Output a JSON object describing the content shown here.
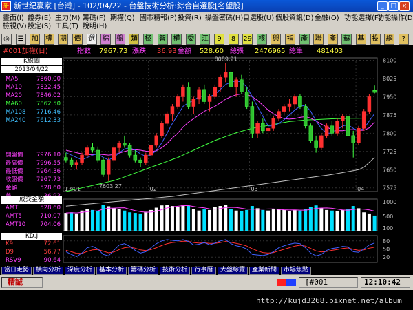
{
  "window": {
    "title": "新世紀贏家 [台灣] - 102/04/22 - 台盤技術分析:綜合自選股[名望股]"
  },
  "menu": [
    {
      "label": "畫面(I)",
      "x": 4,
      "y": 20
    },
    {
      "label": "證券(E)",
      "x": 40,
      "y": 20
    },
    {
      "label": "主力(M)",
      "x": 80,
      "y": 20
    },
    {
      "label": "籌碼(F)",
      "x": 120,
      "y": 20
    },
    {
      "label": "期權(Q)",
      "x": 160,
      "y": 20
    },
    {
      "label": "國市精報(P)",
      "x": 203,
      "y": 20
    },
    {
      "label": "投資(R)",
      "x": 258,
      "y": 20
    },
    {
      "label": "操盤密碼(H)",
      "x": 298,
      "y": 20
    },
    {
      "label": "自選股(U)",
      "x": 353,
      "y": 20
    },
    {
      "label": "個股資訊(D)",
      "x": 400,
      "y": 20
    },
    {
      "label": "金融(O)",
      "x": 457,
      "y": 20
    },
    {
      "label": "功能選擇(F)",
      "x": 500,
      "y": 20
    },
    {
      "label": "功能操作(D)",
      "x": 548,
      "y": 20
    },
    {
      "label": "檢視(V)",
      "x": 4,
      "y": 32
    },
    {
      "label": "設定(S)",
      "x": 40,
      "y": 32
    },
    {
      "label": "工具(T)",
      "x": 80,
      "y": 32
    },
    {
      "label": "說明(H)",
      "x": 120,
      "y": 32
    }
  ],
  "toolbar": [
    {
      "t": "◎",
      "bg": "#d4d0c8"
    },
    {
      "t": "☰",
      "bg": "#d4d0c8"
    },
    {
      "t": "加",
      "bg": "#e0c060"
    },
    {
      "t": "權",
      "bg": "#e0c060"
    },
    {
      "t": "期",
      "bg": "#e0c060"
    },
    {
      "t": "價",
      "bg": "#e0c060"
    },
    {
      "t": "選",
      "bg": "#f0f0f0"
    },
    {
      "t": "綜",
      "bg": "#d080d0"
    },
    {
      "t": "盤",
      "bg": "#d080d0"
    },
    {
      "t": "類",
      "bg": "#d0c040"
    },
    {
      "t": "極",
      "bg": "#70c070"
    },
    {
      "t": "智",
      "bg": "#70c070"
    },
    {
      "t": "權",
      "bg": "#70c070"
    },
    {
      "t": "委",
      "bg": "#70c070"
    },
    {
      "t": "江",
      "bg": "#70c070"
    },
    {
      "t": "9",
      "bg": "#e0e040"
    },
    {
      "t": "8",
      "bg": "#e0e040"
    },
    {
      "t": "29",
      "bg": "#e0e040"
    },
    {
      "t": "核",
      "bg": "#70c070"
    },
    {
      "t": "興",
      "bg": "#e0c060"
    },
    {
      "t": "指",
      "bg": "#e0c060"
    },
    {
      "t": "產",
      "bg": "#70c070"
    },
    {
      "t": "聯",
      "bg": "#e0c060"
    },
    {
      "t": "產",
      "bg": "#e0c060"
    },
    {
      "t": "蘇",
      "bg": "#70c070"
    },
    {
      "t": "基",
      "bg": "#e0c060"
    },
    {
      "t": "投",
      "bg": "#e0c060"
    },
    {
      "t": "網",
      "bg": "#e0c060"
    },
    {
      "t": "?",
      "bg": "#e0c060"
    }
  ],
  "info": {
    "code": "#001",
    "name": "加權(日)",
    "idx_label": "指數",
    "idx_value": "7967.73",
    "chg_label": "漲跌",
    "chg_value": "36.93",
    "amt_label": "金額",
    "amt_value": "528.60",
    "vol_label": "總張",
    "vol_value": "2476965",
    "cnt_label": "總筆",
    "cnt_value": "481403"
  },
  "left": {
    "title": "K線圖",
    "date": "2013/04/22",
    "ma": [
      {
        "k": "MA5",
        "v": "7860.00",
        "c": "#ff40ff"
      },
      {
        "k": "MA10",
        "v": "7822.45",
        "c": "#ff40ff"
      },
      {
        "k": "MA20",
        "v": "7846.02",
        "c": "#ff40ff"
      },
      {
        "k": "MA60",
        "v": "7862.50",
        "c": "#40ff40"
      },
      {
        "k": "MA108",
        "v": "7716.46",
        "c": "#40c0ff"
      },
      {
        "k": "MA240",
        "v": "7612.33",
        "c": "#40c0ff"
      }
    ],
    "stats": [
      {
        "k": "開盤價",
        "v": "7976.10",
        "c": "#ff40ff"
      },
      {
        "k": "最高價",
        "v": "7996.55",
        "c": "#ff40ff"
      },
      {
        "k": "最低價",
        "v": "7964.36",
        "c": "#ff40ff"
      },
      {
        "k": "收盤價",
        "v": "7967.73",
        "c": "#ff40ff"
      },
      {
        "k": "金額",
        "v": "528.60",
        "c": "#ff40ff"
      },
      {
        "k": "差",
        "v": "36.93",
        "c": "#ff40ff"
      }
    ],
    "vol_title": "成交金額",
    "vol_ma": [
      {
        "k": "AMT",
        "v": "528.60",
        "c": "#ff40ff"
      },
      {
        "k": "AMT5",
        "v": "710.07",
        "c": "#ff40ff"
      },
      {
        "k": "AMT10",
        "v": "704.06",
        "c": "#ff40ff"
      }
    ],
    "kd_title": "KD,J",
    "kd": [
      {
        "k": "K9",
        "v": "72.61",
        "c": "#ff4040"
      },
      {
        "k": "D9",
        "v": "56.77",
        "c": "#ff4040"
      },
      {
        "k": "RSV9",
        "v": "90.64",
        "c": "#ff40ff"
      }
    ]
  },
  "chart_data": {
    "type": "candlestick",
    "price_ticks": [
      "8100",
      "8025",
      "7950",
      "7875",
      "7800",
      "7725",
      "7650",
      "7575"
    ],
    "x_ticks": [
      "13/01",
      "02",
      "03",
      "04"
    ],
    "high_label": "8089.21",
    "low_label": "7603.27",
    "candles": [
      [
        7700,
        7720,
        7680,
        7690
      ],
      [
        7690,
        7700,
        7660,
        7670
      ],
      [
        7670,
        7690,
        7650,
        7680
      ],
      [
        7680,
        7720,
        7670,
        7710
      ],
      [
        7710,
        7750,
        7700,
        7740
      ],
      [
        7740,
        7760,
        7720,
        7730
      ],
      [
        7730,
        7745,
        7680,
        7690
      ],
      [
        7690,
        7700,
        7620,
        7630
      ],
      [
        7630,
        7700,
        7603,
        7690
      ],
      [
        7690,
        7750,
        7680,
        7740
      ],
      [
        7740,
        7770,
        7720,
        7760
      ],
      [
        7760,
        7790,
        7740,
        7750
      ],
      [
        7750,
        7760,
        7700,
        7710
      ],
      [
        7710,
        7730,
        7680,
        7690
      ],
      [
        7690,
        7700,
        7660,
        7680
      ],
      [
        7680,
        7720,
        7670,
        7710
      ],
      [
        7710,
        7760,
        7700,
        7750
      ],
      [
        7750,
        7800,
        7740,
        7790
      ],
      [
        7790,
        7850,
        7780,
        7840
      ],
      [
        7840,
        7890,
        7830,
        7880
      ],
      [
        7880,
        7920,
        7850,
        7910
      ],
      [
        7910,
        7960,
        7900,
        7950
      ],
      [
        7950,
        8000,
        7930,
        7990
      ],
      [
        7990,
        8010,
        7900,
        7910
      ],
      [
        7910,
        7950,
        7880,
        7940
      ],
      [
        7940,
        7990,
        7920,
        7980
      ],
      [
        7980,
        8000,
        7920,
        7930
      ],
      [
        7930,
        7960,
        7890,
        7950
      ],
      [
        7950,
        8000,
        7940,
        7990
      ],
      [
        7990,
        8040,
        7970,
        8030
      ],
      [
        8030,
        8089,
        8010,
        8050
      ],
      [
        8050,
        8060,
        7980,
        7990
      ],
      [
        7990,
        8030,
        7950,
        8020
      ],
      [
        8020,
        8040,
        7960,
        7970
      ],
      [
        7970,
        7990,
        7900,
        7910
      ],
      [
        7910,
        7930,
        7780,
        7800
      ],
      [
        7800,
        7850,
        7780,
        7840
      ],
      [
        7840,
        7860,
        7800,
        7810
      ],
      [
        7810,
        7830,
        7780,
        7820
      ],
      [
        7820,
        7870,
        7810,
        7860
      ],
      [
        7860,
        7900,
        7850,
        7890
      ],
      [
        7890,
        7920,
        7880,
        7910
      ],
      [
        7910,
        7940,
        7890,
        7920
      ],
      [
        7920,
        7960,
        7900,
        7950
      ],
      [
        7950,
        7960,
        7900,
        7910
      ],
      [
        7910,
        7920,
        7820,
        7830
      ],
      [
        7830,
        7840,
        7760,
        7770
      ],
      [
        7770,
        7790,
        7720,
        7740
      ],
      [
        7740,
        7800,
        7730,
        7790
      ],
      [
        7790,
        7840,
        7780,
        7830
      ],
      [
        7830,
        7850,
        7790,
        7800
      ],
      [
        7800,
        7860,
        7790,
        7850
      ],
      [
        7850,
        7880,
        7820,
        7870
      ],
      [
        7870,
        7880,
        7780,
        7790
      ],
      [
        7790,
        7810,
        7700,
        7760
      ],
      [
        7760,
        7830,
        7750,
        7820
      ],
      [
        7820,
        7900,
        7810,
        7890
      ],
      [
        7890,
        7960,
        7880,
        7950
      ],
      [
        7976,
        7996,
        7964,
        7968
      ]
    ],
    "ma_short": [
      7720,
      7710,
      7700,
      7690,
      7700,
      7710,
      7715,
      7700,
      7690,
      7700,
      7720,
      7735,
      7740,
      7730,
      7715,
      7705,
      7710,
      7730,
      7760,
      7800,
      7840,
      7875,
      7910,
      7925,
      7935,
      7950,
      7955,
      7950,
      7960,
      7980,
      8000,
      8010,
      8015,
      8010,
      7990,
      7950,
      7910,
      7870,
      7830,
      7830,
      7840,
      7855,
      7875,
      7895,
      7910,
      7915,
      7890,
      7850,
      7820,
      7800,
      7800,
      7815,
      7830,
      7835,
      7820,
      7810,
      7820,
      7850,
      7880
    ],
    "ma_mid": [
      7730,
      7725,
      7720,
      7715,
      7712,
      7712,
      7714,
      7712,
      7710,
      7712,
      7718,
      7725,
      7730,
      7732,
      7730,
      7726,
      7724,
      7728,
      7740,
      7758,
      7780,
      7800,
      7825,
      7845,
      7860,
      7875,
      7890,
      7900,
      7910,
      7925,
      7940,
      7950,
      7958,
      7962,
      7960,
      7950,
      7935,
      7915,
      7895,
      7880,
      7868,
      7860,
      7858,
      7860,
      7865,
      7868,
      7862,
      7850,
      7838,
      7825,
      7815,
      7810,
      7810,
      7815,
      7815,
      7812,
      7812,
      7822,
      7846
    ],
    "ma_long": [
      7560,
      7565,
      7570,
      7575,
      7580,
      7585,
      7590,
      7595,
      7600,
      7605,
      7612,
      7620,
      7628,
      7636,
      7644,
      7652,
      7660,
      7668,
      7676,
      7684,
      7692,
      7700,
      7710,
      7720,
      7730,
      7740,
      7750,
      7760,
      7770,
      7778,
      7786,
      7794,
      7802,
      7808,
      7814,
      7820,
      7824,
      7828,
      7832,
      7836,
      7840,
      7844,
      7848,
      7850,
      7852,
      7854,
      7855,
      7856,
      7857,
      7858,
      7859,
      7860,
      7860,
      7861,
      7861,
      7861,
      7862,
      7862,
      7862
    ],
    "ma_xlong": [
      7500,
      7502,
      7504,
      7506,
      7508,
      7510,
      7512,
      7514,
      7516,
      7518,
      7520,
      7522,
      7524,
      7526,
      7528,
      7530,
      7532,
      7534,
      7536,
      7538,
      7540,
      7543,
      7546,
      7549,
      7552,
      7555,
      7558,
      7561,
      7564,
      7567,
      7570,
      7573,
      7576,
      7579,
      7582,
      7585,
      7588,
      7591,
      7594,
      7597,
      7600,
      7603,
      7606,
      7609,
      7612,
      7615,
      7618,
      7621,
      7624,
      7627,
      7630,
      7634,
      7638,
      7642,
      7646,
      7650,
      7660,
      7680,
      7700
    ],
    "vol_ticks": [
      "1000",
      "500",
      "100"
    ],
    "volumes": [
      620,
      640,
      600,
      700,
      760,
      720,
      680,
      900,
      850,
      780,
      760,
      700,
      640,
      620,
      600,
      660,
      720,
      800,
      880,
      900,
      860,
      820,
      900,
      880,
      760,
      700,
      740,
      720,
      820,
      860,
      900,
      760,
      700,
      680,
      720,
      860,
      780,
      720,
      700,
      740,
      760,
      720,
      680,
      720,
      700,
      760,
      820,
      880,
      780,
      720,
      700,
      680,
      720,
      740,
      860,
      780,
      640,
      600,
      528
    ],
    "kd_ticks": [
      "80",
      "50",
      "20"
    ],
    "k9": [
      40,
      30,
      22,
      35,
      55,
      60,
      50,
      30,
      25,
      45,
      65,
      70,
      60,
      45,
      35,
      40,
      55,
      70,
      80,
      85,
      82,
      80,
      85,
      78,
      65,
      68,
      74,
      66,
      72,
      80,
      85,
      70,
      62,
      58,
      50,
      30,
      28,
      26,
      30,
      40,
      55,
      62,
      68,
      72,
      70,
      55,
      35,
      25,
      30,
      45,
      52,
      55,
      60,
      58,
      40,
      38,
      50,
      65,
      72.61
    ],
    "d9": [
      45,
      40,
      34,
      34,
      41,
      47,
      48,
      42,
      36,
      39,
      48,
      55,
      57,
      53,
      47,
      44,
      48,
      55,
      63,
      70,
      74,
      76,
      79,
      79,
      74,
      72,
      73,
      71,
      71,
      74,
      78,
      75,
      71,
      67,
      61,
      51,
      43,
      37,
      35,
      37,
      43,
      49,
      55,
      61,
      64,
      61,
      52,
      43,
      39,
      41,
      45,
      48,
      52,
      54,
      49,
      45,
      47,
      53,
      56.77
    ]
  },
  "tabs": [
    {
      "label": "當日走勢",
      "w": 44
    },
    {
      "label": "橫向分析",
      "w": 44
    },
    {
      "label": "深度分析",
      "w": 44
    },
    {
      "label": "基本分析",
      "w": 44
    },
    {
      "label": "籌碼分析",
      "w": 44
    },
    {
      "label": "技術分析",
      "w": 44
    },
    {
      "label": "行事曆",
      "w": 36
    },
    {
      "label": "大盤綜覽",
      "w": 44
    },
    {
      "label": "產業新聞",
      "w": 44
    },
    {
      "label": "市場焦點",
      "w": 44
    }
  ],
  "status": {
    "left": "精誠",
    "code": "[#001",
    "time": "12:10:42"
  },
  "bottom": {
    "url": "http://kujd3268.pixnet.net/album"
  }
}
